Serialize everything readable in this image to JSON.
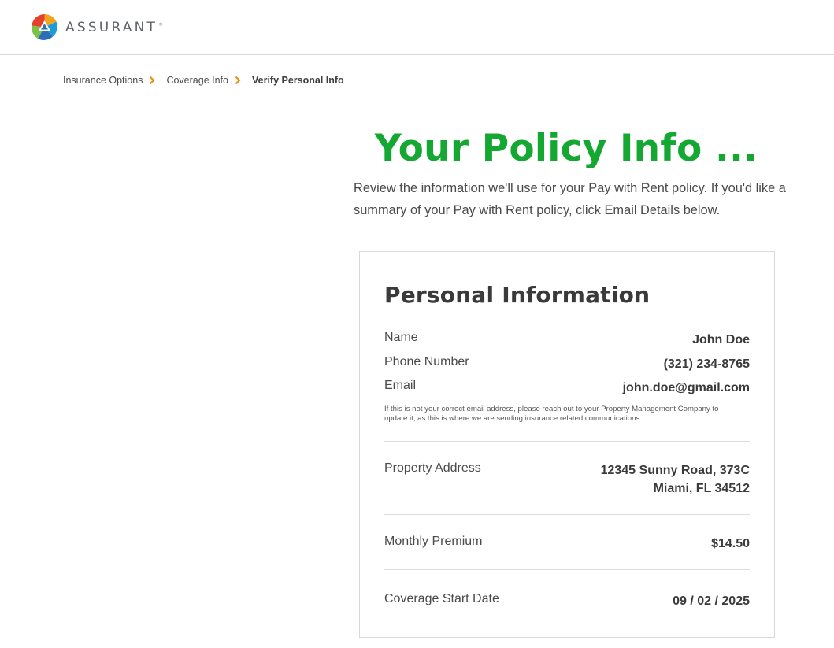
{
  "header": {
    "brand": "ASSURANT",
    "reg": "®",
    "logo_icon": "assurant-logo-icon"
  },
  "breadcrumb": {
    "items": [
      {
        "label": "Insurance Options"
      },
      {
        "label": "Coverage Info"
      },
      {
        "label": "Verify Personal Info"
      }
    ],
    "chevron_color": "#e8901a"
  },
  "page": {
    "title": "Your Policy Info ...",
    "intro": "Review the information we'll use for your Pay with Rent policy. If you'd like a summary of your Pay with Rent policy, click Email Details below."
  },
  "personal_info": {
    "heading": "Personal Information",
    "name_label": "Name",
    "name_value": "John Doe",
    "phone_label": "Phone Number",
    "phone_value": "(321) 234-8765",
    "email_label": "Email",
    "email_value": "john.doe@gmail.com",
    "email_note": "If this is not your correct email address, please reach out to your Property Management Company to update it, as this is where we are sending insurance related communications.",
    "address_label": "Property Address",
    "address_line1": "12345 Sunny Road, 373C",
    "address_line2": "Miami, FL 34512",
    "premium_label": "Monthly Premium",
    "premium_value": "$14.50",
    "start_label": "Coverage Start Date",
    "start_value": "09 / 02 / 2025"
  },
  "colors": {
    "title_green": "#14a832",
    "text": "#4a4a4a",
    "border": "#d9d9d9"
  }
}
